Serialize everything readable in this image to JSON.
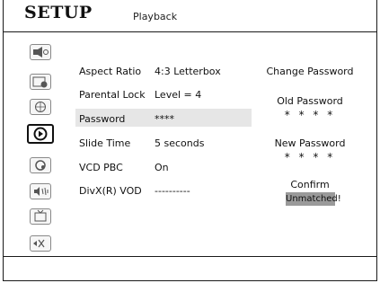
{
  "header": {
    "title": "SETUP",
    "subtitle": "Playback"
  },
  "sidebar": {
    "icons": [
      {
        "name": "speaker-icon",
        "active": false
      },
      {
        "name": "clock-icon",
        "active": false
      },
      {
        "name": "globe-icon",
        "active": false
      },
      {
        "name": "playback-icon",
        "active": true
      },
      {
        "name": "refresh-icon",
        "active": false
      },
      {
        "name": "audio-icon",
        "active": false
      },
      {
        "name": "tv-icon",
        "active": false
      },
      {
        "name": "exit-icon",
        "active": false
      }
    ]
  },
  "settings": {
    "rows": [
      {
        "label": "Aspect Ratio",
        "value": "4:3 Letterbox"
      },
      {
        "label": "Parental Lock",
        "value": "Level = 4"
      },
      {
        "label": "Password",
        "value": "****"
      },
      {
        "label": "Slide Time",
        "value": "5 seconds"
      },
      {
        "label": "VCD PBC",
        "value": "On"
      },
      {
        "label": "DivX(R) VOD",
        "value": "----------"
      }
    ],
    "selected_index": 2
  },
  "password_panel": {
    "title": "Change Password",
    "old_label": "Old Password",
    "old_value": "* * * *",
    "new_label": "New Password",
    "new_value": "* * * *",
    "confirm_label": "Confirm",
    "status": "Unmatched!"
  }
}
